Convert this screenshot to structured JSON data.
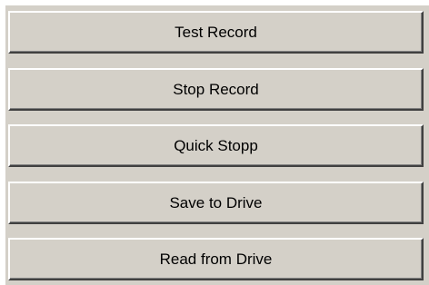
{
  "buttons": [
    {
      "label": "Test Record"
    },
    {
      "label": "Stop Record"
    },
    {
      "label": "Quick Stopp"
    },
    {
      "label": "Save to Drive"
    },
    {
      "label": "Read from Drive"
    }
  ],
  "colors": {
    "face": "#d4d0c8",
    "highlight": "#ffffff",
    "shadow": "#808080",
    "dark_shadow": "#404040",
    "text": "#000000"
  }
}
